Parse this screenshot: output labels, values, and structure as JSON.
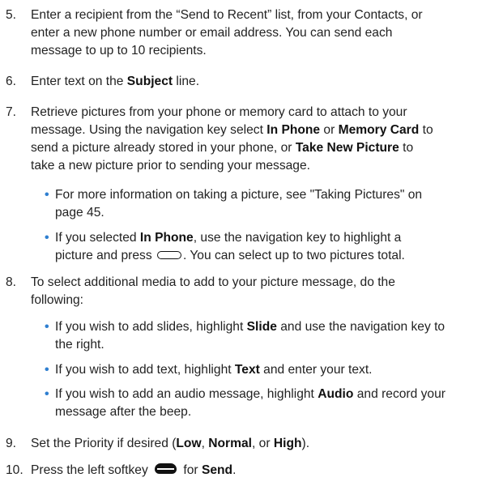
{
  "steps": {
    "s5": {
      "num": "5.",
      "l1": "Enter a recipient from the “Send to Recent” list, from your Contacts, or",
      "l2": "enter a new phone number or email address. You can send each",
      "l3": "message to up to 10 recipients."
    },
    "s6": {
      "num": "6.",
      "a": "Enter text on the ",
      "b": "Subject",
      "c": " line."
    },
    "s7": {
      "num": "7.",
      "l1": "Retrieve pictures from your phone or memory card to attach to your",
      "l2a": "message. Using the navigation key select ",
      "l2b": "In Phone",
      "l2c": " or ",
      "l2d": "Memory Card",
      "l2e": " to",
      "l3a": "send a picture already stored in your phone, or ",
      "l3b": "Take New Picture",
      "l3c": " to",
      "l4": "take a new picture prior to sending your message.",
      "b1": {
        "l1": "For more information on taking a picture, see \"Taking Pictures\" on",
        "l2": "page 45."
      },
      "b2": {
        "l1a": "If you selected ",
        "l1b": "In Phone",
        "l1c": ", use the navigation key to highlight a",
        "l2a": "picture and press ",
        "l2b": ". You can select up to two pictures total."
      }
    },
    "s8": {
      "num": "8.",
      "l1": "To select additional media to add to your picture message, do the",
      "l2": "following:",
      "b1": {
        "l1a": "If you wish to add slides, highlight ",
        "l1b": "Slide",
        "l1c": " and use the navigation key to",
        "l2": "the right."
      },
      "b2": {
        "a": "If you wish to add text, highlight ",
        "b": "Text",
        "c": " and enter your text."
      },
      "b3": {
        "l1a": "If you wish to add an audio message, highlight ",
        "l1b": "Audio",
        "l1c": " and record your",
        "l2": "message after the beep."
      }
    },
    "s9": {
      "num": "9.",
      "a": "Set the Priority if desired (",
      "b": "Low",
      "c": ", ",
      "d": "Normal",
      "e": ", or ",
      "f": "High",
      "g": ")."
    },
    "s10": {
      "num": "10.",
      "a": "Press the left softkey ",
      "b": " for ",
      "c": "Send",
      "d": "."
    }
  },
  "bullet_symbol": "•",
  "colors": {
    "text": "#222222",
    "bullet": "#2f7fd0"
  },
  "icons": {
    "select_key": "oval-outline-key-icon",
    "left_softkey": "left-softkey-icon"
  }
}
